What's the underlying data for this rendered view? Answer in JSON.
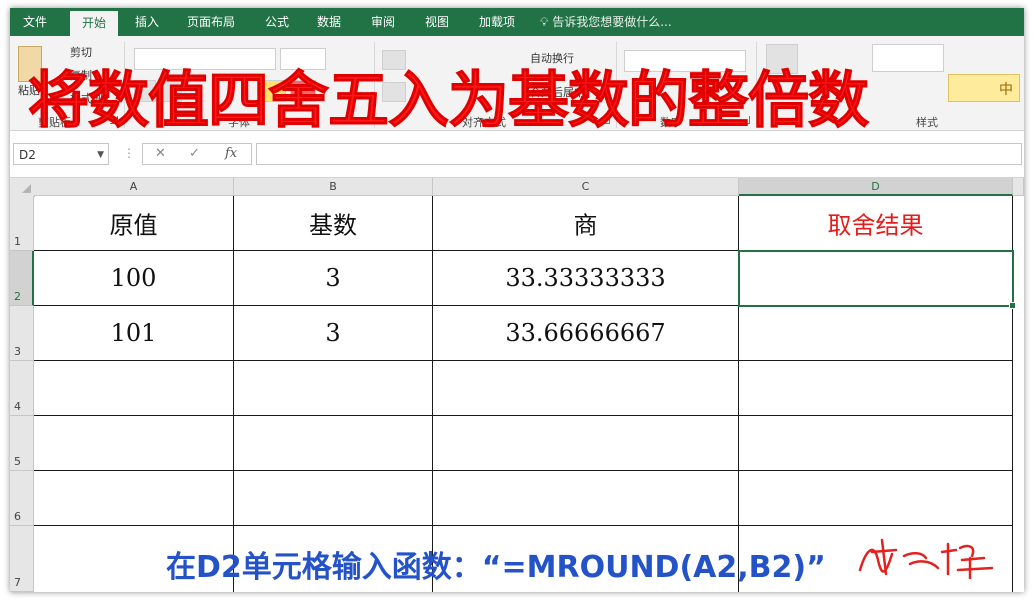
{
  "ribbon": {
    "tabs": [
      "文件",
      "开始",
      "插入",
      "页面布局",
      "公式",
      "数据",
      "审阅",
      "视图",
      "加载项"
    ],
    "active_tab": "开始",
    "tell_me": "告诉我您想要做什么...",
    "groups": [
      "剪贴板",
      "字体",
      "对齐方式",
      "数字",
      "样式"
    ],
    "clipboard": {
      "paste": "粘贴",
      "cut": "剪切",
      "copy": "复制",
      "format_painter": "格式刷"
    },
    "alignment": {
      "wrap": "自动换行",
      "merge": "合并后居中"
    },
    "styles": {
      "cell_style": "中"
    }
  },
  "overlay_title": "将数值四舍五入为基数的整倍数",
  "formula_bar": {
    "name_box": "D2",
    "cancel": "✕",
    "enter": "✓",
    "fx": "fx",
    "value": ""
  },
  "sheet": {
    "columns": [
      "A",
      "B",
      "C",
      "D"
    ],
    "selected_column": "D",
    "rows": [
      "1",
      "2",
      "3",
      "4",
      "5",
      "6",
      "7"
    ],
    "selected_row": "2",
    "headers": [
      "原值",
      "基数",
      "商",
      "取舍结果"
    ],
    "data": [
      [
        "100",
        "3",
        "33.33333333",
        ""
      ],
      [
        "101",
        "3",
        "33.66666667",
        ""
      ]
    ],
    "active_cell": "D2"
  },
  "caption": "在D2单元格输入函数：“=MROUND(A2,B2)”",
  "colors": {
    "excel_green": "#217346",
    "title_red": "#ff1a1a",
    "result_red": "#e51c1c",
    "caption_blue": "#2453c8"
  }
}
